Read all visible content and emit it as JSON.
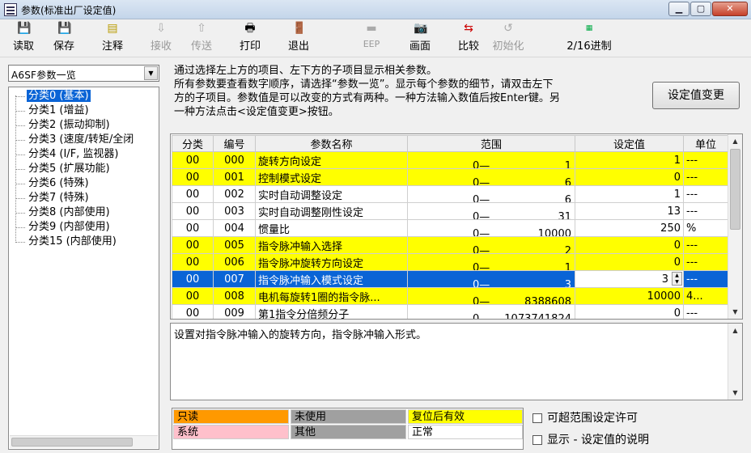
{
  "window": {
    "title": "参数(标准出厂设定值)",
    "min_icon": "minimize-icon",
    "max_icon": "maximize-icon",
    "close_icon": "close-icon"
  },
  "toolbar": {
    "read": {
      "label": "读取",
      "icon": "floppy-read-icon"
    },
    "save": {
      "label": "保存",
      "icon": "floppy-save-icon"
    },
    "comment": {
      "label": "注释",
      "icon": "note-icon"
    },
    "receive": {
      "label": "接收",
      "icon": "receive-icon"
    },
    "send": {
      "label": "传送",
      "icon": "send-icon"
    },
    "print": {
      "label": "打印",
      "icon": "printer-icon"
    },
    "exit": {
      "label": "退出",
      "icon": "exit-door-icon"
    },
    "eep": {
      "label": "EEP",
      "icon": "eep-icon"
    },
    "screen": {
      "label": "画面",
      "icon": "camera-icon"
    },
    "compare": {
      "label": "比较",
      "icon": "compare-icon"
    },
    "init": {
      "label": "初始化",
      "icon": "initialize-icon"
    },
    "radix": {
      "label": "2/16进制",
      "icon": "hex-icon"
    }
  },
  "left": {
    "combo_value": "A6SF参数一览",
    "tree": [
      {
        "label": "分类0 (基本)",
        "selected": true
      },
      {
        "label": "分类1 (增益)"
      },
      {
        "label": "分类2 (振动抑制)"
      },
      {
        "label": "分类3 (速度/转矩/全闭"
      },
      {
        "label": "分类4 (I/F, 监视器)"
      },
      {
        "label": "分类5 (扩展功能)"
      },
      {
        "label": "分类6 (特殊)"
      },
      {
        "label": "分类7 (特殊)"
      },
      {
        "label": "分类8 (内部使用)"
      },
      {
        "label": "分类9 (内部使用)"
      },
      {
        "label": "分类15 (内部使用)"
      }
    ]
  },
  "info": {
    "line1": "通过选择左上方的项目、左下方的子项目显示相关参数。",
    "line2": "所有参数要查看数字顺序，请选择“参数一览”。显示每个参数的细节，请双击左下",
    "line3": "方的子项目。参数值是可以改变的方式有两种。一种方法输入数值后按Enter键。另",
    "line4": "一种方法点击<设定值变更>按钮。"
  },
  "set_button": "设定值变更",
  "table": {
    "headers": [
      "分类",
      "编号",
      "参数名称",
      "范围",
      "设定值",
      "单位"
    ],
    "rows": [
      {
        "cat": "00",
        "no": "000",
        "name": "旋转方向设定",
        "rmin": "0—",
        "rmax": "1",
        "value": "1",
        "unit": "---",
        "style": "yellow"
      },
      {
        "cat": "00",
        "no": "001",
        "name": "控制模式设定",
        "rmin": "0—",
        "rmax": "6",
        "value": "0",
        "unit": "---",
        "style": "yellow"
      },
      {
        "cat": "00",
        "no": "002",
        "name": "实时自动调整设定",
        "rmin": "0—",
        "rmax": "6",
        "value": "1",
        "unit": "---",
        "style": ""
      },
      {
        "cat": "00",
        "no": "003",
        "name": "实时自动调整刚性设定",
        "rmin": "0—",
        "rmax": "31",
        "value": "13",
        "unit": "---",
        "style": ""
      },
      {
        "cat": "00",
        "no": "004",
        "name": "惯量比",
        "rmin": "0—",
        "rmax": "10000",
        "value": "250",
        "unit": "%",
        "style": ""
      },
      {
        "cat": "00",
        "no": "005",
        "name": "指令脉冲输入选择",
        "rmin": "0—",
        "rmax": "2",
        "value": "0",
        "unit": "---",
        "style": "yellow"
      },
      {
        "cat": "00",
        "no": "006",
        "name": "指令脉冲旋转方向设定",
        "rmin": "0—",
        "rmax": "1",
        "value": "0",
        "unit": "---",
        "style": "yellow"
      },
      {
        "cat": "00",
        "no": "007",
        "name": "指令脉冲输入模式设定",
        "rmin": "0—",
        "rmax": "3",
        "value": "3",
        "unit": "---",
        "style": "selected"
      },
      {
        "cat": "00",
        "no": "008",
        "name": "电机每旋转1圈的指令脉...",
        "rmin": "0—",
        "rmax": "8388608",
        "value": "10000",
        "unit": "4...",
        "style": "yellow"
      },
      {
        "cat": "00",
        "no": "009",
        "name": "第1指令分倍频分子",
        "rmin": "0—",
        "rmax": "1073741824",
        "value": "0",
        "unit": "---",
        "style": ""
      }
    ]
  },
  "description": "设置对指令脉冲输入的旋转方向，指令脉冲输入形式。",
  "legend": {
    "readonly": "只读",
    "unused": "未使用",
    "reset": "复位后有效",
    "system": "系统",
    "other": "其他",
    "normal": "正常",
    "colors": {
      "readonly": "#ff9900",
      "unused": "#a0a0a0",
      "reset": "#ffff00",
      "system": "#ffc0cb",
      "other": "#a0a0a0",
      "normal": "#ffffff"
    }
  },
  "checks": {
    "allow_over_range": "可超范围设定许可",
    "show_description": "显示 - 设定值的说明"
  }
}
